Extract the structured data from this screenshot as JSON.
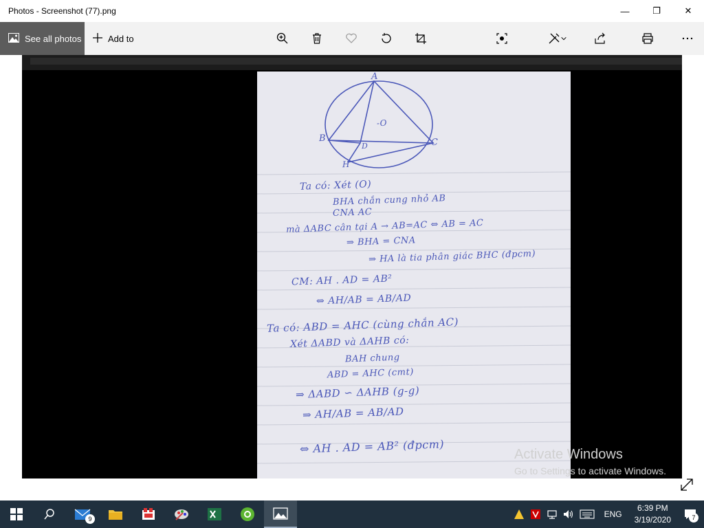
{
  "window": {
    "title": "Photos - Screenshot (77).png",
    "minimize_glyph": "—",
    "maximize_glyph": "❐",
    "close_glyph": "✕"
  },
  "toolbar": {
    "see_all_label": "See all photos",
    "add_to_label": "Add to",
    "icons": [
      "zoom-icon",
      "delete-icon",
      "favorite-icon",
      "rotate-icon",
      "crop-icon",
      "enhance-icon",
      "edit-icon",
      "share-icon",
      "print-icon",
      "more-icon"
    ]
  },
  "photo": {
    "handwriting": [
      "Ta có: Xét (O)",
      "BHA chắn cung nhỏ AB",
      "CNA                       AC",
      "mà ΔABC cân tại A → AB=AC ⇔ AB = AC",
      "⇒ BHA = CNA",
      "⇒ HA là tia phân giác BHC (đpcm)",
      "CM: AH . AD = AB²",
      "⇔ AH/AB = AB/AD",
      "Ta có: ABD = AHC (cùng chắn AC)",
      "Xét ΔABD và ΔAHB có:",
      "BAH chung",
      "ABD = AHC (cmt)",
      "⇒ ΔABD ∽ ΔAHB (g-g)",
      "⇒ AH/AB = AB/AD",
      "⇔ AH . AD = AB² (đpcm)"
    ],
    "diagram_labels": [
      "A",
      "B",
      "C",
      "H",
      "D",
      "-O"
    ]
  },
  "watermark": {
    "line1": "Activate Windows",
    "line2": "Go to Settings to activate Windows."
  },
  "taskbar": {
    "mail_badge": "9",
    "notification_badge": "7",
    "language": "ENG",
    "time": "6:39 PM",
    "date": "3/19/2020"
  },
  "colors": {
    "taskbar": "#20303e",
    "see_all_bg": "#5c5c5c",
    "ink": "#4a57b8",
    "paper": "#e8e8ef"
  }
}
